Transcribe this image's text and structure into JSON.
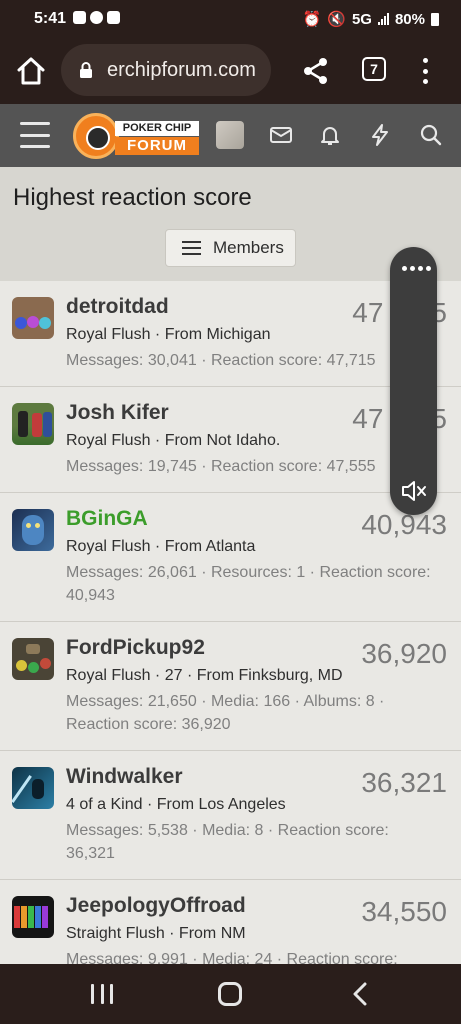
{
  "status_bar": {
    "time": "5:41",
    "network": "5G",
    "battery": "80%"
  },
  "browser": {
    "url": "erchipforum.com",
    "tab_count": "7"
  },
  "site": {
    "logo_line1": "POKER CHIP",
    "logo_line2": "FORUM"
  },
  "page": {
    "title": "Highest reaction score",
    "members_button": "Members"
  },
  "members": [
    {
      "name": "detroitdad",
      "score": "47,715",
      "score_shown": "47",
      "score_tail": "5",
      "line1": "Royal Flush · From Michigan",
      "line2": "Messages: 30,041 · Reaction score: 47,715",
      "highlight": false
    },
    {
      "name": "Josh Kifer",
      "score": "47,555",
      "score_shown": "47",
      "score_tail": "5",
      "line1": "Royal Flush · From Not Idaho.",
      "line2": "Messages: 19,745 · Reaction score: 47,555",
      "highlight": false
    },
    {
      "name": "BGinGA",
      "score": "40,943",
      "line1": "Royal Flush · From Atlanta",
      "line2": "Messages: 26,061 · Resources: 1 · Reaction score: 40,943",
      "highlight": true
    },
    {
      "name": "FordPickup92",
      "score": "36,920",
      "line1": "Royal Flush · 27 · From Finksburg, MD",
      "line2": "Messages: 21,650 · Media: 166 · Albums: 8 · Reaction score: 36,920",
      "highlight": false
    },
    {
      "name": "Windwalker",
      "score": "36,321",
      "line1": "4 of a Kind · From Los Angeles",
      "line2": "Messages: 5,538 · Media: 8 · Reaction score: 36,321",
      "highlight": false
    },
    {
      "name": "JeepologyOffroad",
      "score": "34,550",
      "line1": "Straight Flush · From NM",
      "line2": "Messages: 9,991 · Media: 24 · Reaction score:",
      "highlight": false
    }
  ],
  "colors": {
    "system_bar": "#2a1e1b",
    "site_header": "#545454",
    "highlight_name": "#3c9d2b",
    "logo_orange": "#f07f1e"
  }
}
